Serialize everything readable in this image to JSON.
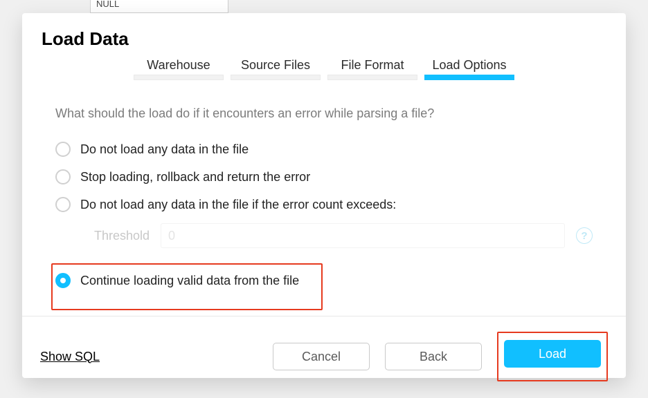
{
  "background": {
    "cell_text": "NULL"
  },
  "dialog": {
    "title": "Load Data",
    "tabs": [
      {
        "label": "Warehouse",
        "active": false
      },
      {
        "label": "Source Files",
        "active": false
      },
      {
        "label": "File Format",
        "active": false
      },
      {
        "label": "Load Options",
        "active": true
      }
    ],
    "question": "What should the load do if it encounters an error while parsing a file?",
    "options": [
      {
        "label": "Do not load any data in the file",
        "checked": false
      },
      {
        "label": "Stop loading, rollback and return the error",
        "checked": false
      },
      {
        "label": "Do not load any data in the file if the error count exceeds:",
        "checked": false
      },
      {
        "label": "Continue loading valid data from the file",
        "checked": true
      }
    ],
    "threshold": {
      "label": "Threshold",
      "placeholder": "0",
      "value": ""
    },
    "footer": {
      "show_sql": "Show SQL",
      "cancel": "Cancel",
      "back": "Back",
      "load": "Load"
    }
  }
}
